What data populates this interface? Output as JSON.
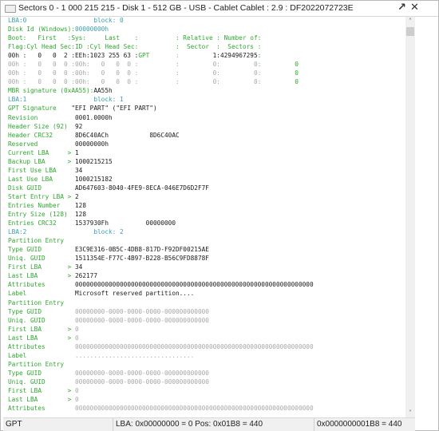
{
  "window": {
    "title": "Sectors 0 - 1 000 215 215 - Disk 1 - 512 GB - USB - Cablet Cablet : 2.9 : DF2022072723E",
    "icons": [
      "window-icon",
      "undock-arrow-icon",
      "close-icon"
    ],
    "undock_glyph": "↗",
    "close_glyph": "✕"
  },
  "colors": {
    "label": "#2fa82f",
    "lba_header": "#3a9fb0",
    "value": "#1a1a1a",
    "empty_value": "#a8a8a8"
  },
  "lines": [
    [
      [
        "LBA:0                  ",
        "t"
      ],
      [
        "block: 0",
        "t"
      ]
    ],
    [
      [
        "Disk Id (Windows):",
        "g"
      ],
      [
        "00000000h",
        "t"
      ]
    ],
    [
      [
        "Boot:   First   :Sys:     Last    :          : Relative : Number of:",
        "g"
      ]
    ],
    [
      [
        "Flag:Cyl Head Sec:ID :Cyl Head Sec:          :  Sector  :  Sectors :",
        "g"
      ]
    ],
    [
      [
        "00h :   0   0  2 :EEh:1023 255 63 :",
        "k"
      ],
      [
        "GPT",
        "g"
      ],
      [
        "       :",
        "d"
      ],
      [
        "         1:4294967295",
        "k"
      ],
      [
        ":",
        "g"
      ]
    ],
    [
      [
        "00h :   0   0  0 :00h:   0   0  0 :          :         0:         0:",
        "d"
      ],
      [
        "         0",
        "g"
      ]
    ],
    [
      [
        "00h :   0   0  0 :00h:   0   0  0 :          :         0:         0:",
        "d"
      ],
      [
        "         0",
        "g"
      ]
    ],
    [
      [
        "00h :   0   0  0 :00h:   0   0  0 :          :         0:         0:",
        "d"
      ],
      [
        "         0",
        "g"
      ]
    ],
    [
      [
        "MBR signature (0xAA55):",
        "g"
      ],
      [
        "AA55h",
        "k"
      ]
    ],
    [
      [
        "LBA:1                  ",
        "t"
      ],
      [
        "block: 1",
        "t"
      ]
    ],
    [
      [
        "GPT Signature    ",
        "g"
      ],
      [
        "\"EFI PART\" (\"EFI PART\")",
        "k"
      ]
    ],
    [
      [
        "Revision          ",
        "g"
      ],
      [
        "0001.0000h",
        "k"
      ]
    ],
    [
      [
        "Header Size (92)  ",
        "g"
      ],
      [
        "92",
        "k"
      ]
    ],
    [
      [
        "Header CRC32      ",
        "g"
      ],
      [
        "8D6C40ACh           8D6C40AC",
        "k"
      ]
    ],
    [
      [
        "Reserved          ",
        "g"
      ],
      [
        "00000000h",
        "k"
      ]
    ],
    [
      [
        "Current LBA     > ",
        "g"
      ],
      [
        "1",
        "k"
      ]
    ],
    [
      [
        "Backup LBA      > ",
        "g"
      ],
      [
        "1000215215",
        "k"
      ]
    ],
    [
      [
        "First Use LBA     ",
        "g"
      ],
      [
        "34",
        "k"
      ]
    ],
    [
      [
        "Last Use LBA      ",
        "g"
      ],
      [
        "1000215182",
        "k"
      ]
    ],
    [
      [
        "Disk GUID         ",
        "g"
      ],
      [
        "AD647603-8040-4FE9-8ECA-046E7D6D2F7F",
        "k"
      ]
    ],
    [
      [
        "Start Entry LBA > ",
        "g"
      ],
      [
        "2",
        "k"
      ]
    ],
    [
      [
        "Entries Number    ",
        "g"
      ],
      [
        "128",
        "k"
      ]
    ],
    [
      [
        "Entry Size (128)  ",
        "g"
      ],
      [
        "128",
        "k"
      ]
    ],
    [
      [
        "Entries CRC32     ",
        "g"
      ],
      [
        "1537930Fh          00000000",
        "k"
      ]
    ],
    [
      [
        "LBA:2                  ",
        "t"
      ],
      [
        "block: 2",
        "t"
      ]
    ],
    [
      [
        "Partition Entry",
        "g"
      ]
    ],
    [
      [
        "Type GUID         ",
        "g"
      ],
      [
        "E3C9E316-0B5C-4DB8-817D-F92DF00215AE",
        "k"
      ]
    ],
    [
      [
        "Uniq. GUID        ",
        "g"
      ],
      [
        "1511354E-F77C-4B97-B228-B56C9FD8878F",
        "k"
      ]
    ],
    [
      [
        "First LBA       > ",
        "g"
      ],
      [
        "34",
        "k"
      ]
    ],
    [
      [
        "Last LBA        > ",
        "g"
      ],
      [
        "262177",
        "k"
      ]
    ],
    [
      [
        "Attributes        ",
        "g"
      ],
      [
        "0000000000000000000000000000000000000000000000000000000000000000",
        "k"
      ]
    ],
    [
      [
        "Label             ",
        "g"
      ],
      [
        "Microsoft reserved partition....",
        "k"
      ]
    ],
    [
      [
        "Partition Entry",
        "g"
      ]
    ],
    [
      [
        "Type GUID         ",
        "g"
      ],
      [
        "00000000-0000-0000-0000-000000000000",
        "d"
      ]
    ],
    [
      [
        "Uniq. GUID        ",
        "g"
      ],
      [
        "00000000-0000-0000-0000-000000000000",
        "d"
      ]
    ],
    [
      [
        "First LBA       > ",
        "g"
      ],
      [
        "0",
        "d"
      ]
    ],
    [
      [
        "Last LBA        > ",
        "g"
      ],
      [
        "0",
        "d"
      ]
    ],
    [
      [
        "Attributes        ",
        "g"
      ],
      [
        "0000000000000000000000000000000000000000000000000000000000000000",
        "d"
      ]
    ],
    [
      [
        "Label             ",
        "g"
      ],
      [
        "................................",
        "d"
      ]
    ],
    [
      [
        "Partition Entry",
        "g"
      ]
    ],
    [
      [
        "Type GUID         ",
        "g"
      ],
      [
        "00000000-0000-0000-0000-000000000000",
        "d"
      ]
    ],
    [
      [
        "Uniq. GUID        ",
        "g"
      ],
      [
        "00000000-0000-0000-0000-000000000000",
        "d"
      ]
    ],
    [
      [
        "First LBA       > ",
        "g"
      ],
      [
        "0",
        "d"
      ]
    ],
    [
      [
        "Last LBA        > ",
        "g"
      ],
      [
        "0",
        "d"
      ]
    ],
    [
      [
        "Attributes        ",
        "g"
      ],
      [
        "0000000000000000000000000000000000000000000000000000000000000000",
        "d"
      ]
    ]
  ],
  "scrollbar": {
    "up_glyph": "˄",
    "down_glyph": "˅",
    "position_percent": 2
  },
  "statusbar": {
    "mode": "GPT",
    "position": "LBA: 0x00000000 = 0  Pos: 0x01B8 = 440",
    "offset": "0x0000000001B8 = 440"
  }
}
